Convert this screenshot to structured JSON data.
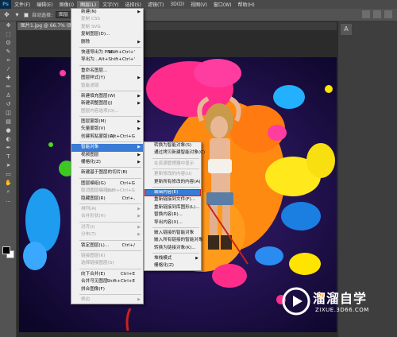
{
  "app": {
    "logo": "Ps"
  },
  "menubar": [
    "文件(F)",
    "编辑(E)",
    "图像(I)",
    "图层(L)",
    "文字(Y)",
    "选择(S)",
    "滤镜(T)",
    "3D(D)",
    "视图(V)",
    "窗口(W)",
    "帮助(H)"
  ],
  "optbar": {
    "auto_select": "自动选择:",
    "layer_dropdown": "图层"
  },
  "doc_tab": {
    "title": "图片1.jpg @ 66.7% (图层 1, RGB/8#)",
    "close": "×"
  },
  "main_menu": [
    {
      "label": "新建(N)",
      "arrow": true
    },
    {
      "label": "复制 CSS",
      "disabled": true
    },
    {
      "label": "复制 SVG",
      "disabled": true
    },
    {
      "label": "复制图层(D)..."
    },
    {
      "label": "删除",
      "arrow": true
    },
    {
      "sep": true
    },
    {
      "label": "快速导出为 PNG",
      "shortcut": "Shift+Ctrl+'"
    },
    {
      "label": "导出为...",
      "shortcut": "Alt+Shift+Ctrl+'"
    },
    {
      "sep": true
    },
    {
      "label": "重命名图层..."
    },
    {
      "label": "图层样式(Y)",
      "arrow": true
    },
    {
      "label": "智能滤镜",
      "disabled": true
    },
    {
      "sep": true
    },
    {
      "label": "新建填充图层(W)",
      "arrow": true
    },
    {
      "label": "新建调整图层(J)",
      "arrow": true
    },
    {
      "label": "图层内容选项(O)...",
      "disabled": true
    },
    {
      "sep": true
    },
    {
      "label": "图层蒙版(M)",
      "arrow": true
    },
    {
      "label": "矢量蒙版(V)",
      "arrow": true
    },
    {
      "label": "创建剪贴蒙版(C)",
      "shortcut": "Alt+Ctrl+G"
    },
    {
      "sep": true
    },
    {
      "label": "智能对象",
      "arrow": true,
      "highlight": true
    },
    {
      "label": "视频图层",
      "arrow": true
    },
    {
      "label": "栅格化(Z)",
      "arrow": true
    },
    {
      "sep": true
    },
    {
      "label": "新建基于图层的切片(B)"
    },
    {
      "sep": true
    },
    {
      "label": "图层编组(G)",
      "shortcut": "Ctrl+G"
    },
    {
      "label": "取消图层编组(U)",
      "shortcut": "Shift+Ctrl+G",
      "disabled": true
    },
    {
      "label": "隐藏图层(R)",
      "shortcut": "Ctrl+,"
    },
    {
      "sep": true
    },
    {
      "label": "排列(A)",
      "arrow": true,
      "disabled": true
    },
    {
      "label": "合并形状(H)",
      "arrow": true,
      "disabled": true
    },
    {
      "sep": true
    },
    {
      "label": "对齐(I)",
      "arrow": true,
      "disabled": true
    },
    {
      "label": "分布(T)",
      "arrow": true,
      "disabled": true
    },
    {
      "sep": true
    },
    {
      "label": "锁定图层(L)...",
      "shortcut": "Ctrl+/"
    },
    {
      "sep": true
    },
    {
      "label": "链接图层(K)",
      "disabled": true
    },
    {
      "label": "选择链接图层(S)",
      "disabled": true
    },
    {
      "sep": true
    },
    {
      "label": "向下合并(E)",
      "shortcut": "Ctrl+E"
    },
    {
      "label": "合并可见图层",
      "shortcut": "Shift+Ctrl+E"
    },
    {
      "label": "拼合图像(F)"
    },
    {
      "sep": true
    },
    {
      "label": "修边",
      "arrow": true,
      "disabled": true
    }
  ],
  "sub_menu": [
    {
      "label": "转换为智能对象(S)"
    },
    {
      "label": "通过拷贝新建智能对象(C)"
    },
    {
      "sep": true
    },
    {
      "label": "在资源管理器中显示",
      "disabled": true
    },
    {
      "sep": true
    },
    {
      "label": "更新修改的内容(U)",
      "disabled": true
    },
    {
      "label": "更新所有修改的内容(A)"
    },
    {
      "sep": true
    },
    {
      "label": "编辑内容(E)",
      "highlight": true
    },
    {
      "label": "重新链接到文件(F)..."
    },
    {
      "label": "重新链接到库图形(L)..."
    },
    {
      "label": "替换内容(R)..."
    },
    {
      "label": "导出内容(X)..."
    },
    {
      "sep": true
    },
    {
      "label": "嵌入链接的智能对象"
    },
    {
      "label": "嵌入所有链接的智能对象"
    },
    {
      "label": "转换为链接对象(K)..."
    },
    {
      "sep": true
    },
    {
      "label": "堆栈模式",
      "arrow": true
    },
    {
      "label": "栅格化(Z)"
    }
  ],
  "watermark": {
    "text": "溜溜自学",
    "url": "ZIXUE.3D66.COM"
  },
  "colors": {
    "highlight": "#3a7bd5",
    "annotation": "#cc2020",
    "canvas_bg": "#130a3a"
  }
}
